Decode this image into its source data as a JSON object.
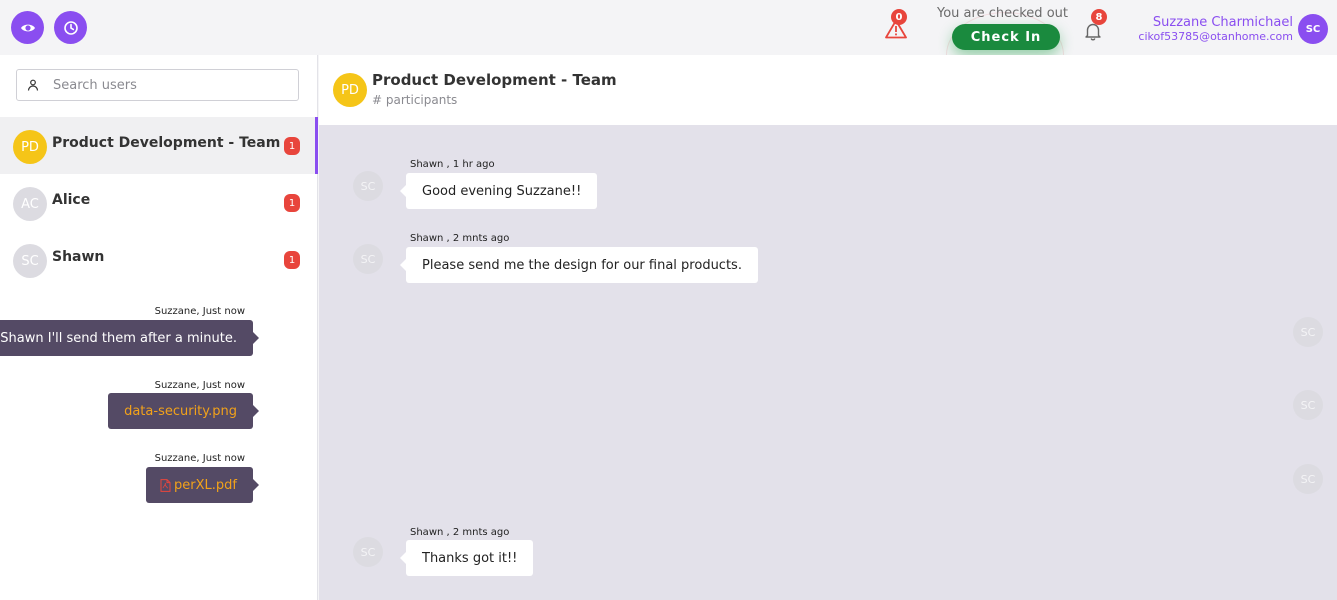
{
  "header": {
    "alert_count": "0",
    "checkout_status": "You are checked out",
    "checkin_label": "Check In",
    "notification_count": "8",
    "user_name": "Suzzane Charmichael",
    "user_email": "cikof53785@otanhome.com",
    "user_initials": "SC"
  },
  "sidebar": {
    "search_placeholder": "Search users",
    "contacts": [
      {
        "initials": "PD",
        "name": "Product Development - Team",
        "unread": "1",
        "color": "#f5c518"
      },
      {
        "initials": "AC",
        "name": "Alice",
        "unread": "1",
        "color": "#dcdbe1"
      },
      {
        "initials": "SC",
        "name": "Shawn",
        "unread": "1",
        "color": "#dcdbe1"
      }
    ]
  },
  "chat": {
    "initials": "PD",
    "title": "Product Development - Team",
    "subtitle": "# participants",
    "messages": [
      {
        "sender": "Shawn , 1 hr ago",
        "initials": "SC",
        "text": "Good evening Suzzane!!"
      },
      {
        "sender": "Shawn , 2 mnts ago",
        "initials": "SC",
        "text": "Please send me the design for our final products."
      },
      {
        "sender": "Suzzane, Just now",
        "initials": "SC",
        "text": "Sure Shawn I'll send them after a minute."
      },
      {
        "sender": "Suzzane, Just now",
        "initials": "SC",
        "text": "data-security.png"
      },
      {
        "sender": "Suzzane, Just now",
        "initials": "SC",
        "text": "perXL.pdf"
      },
      {
        "sender": "Shawn , 2 mnts ago",
        "initials": "SC",
        "text": "Thanks got it!!"
      }
    ]
  },
  "colors": {
    "accent": "#8a4ef0",
    "checkin_green": "#1a8a3e",
    "badge_red": "#e8453c",
    "outgoing_bubble": "#544a65",
    "file_link": "#f2a21a"
  }
}
